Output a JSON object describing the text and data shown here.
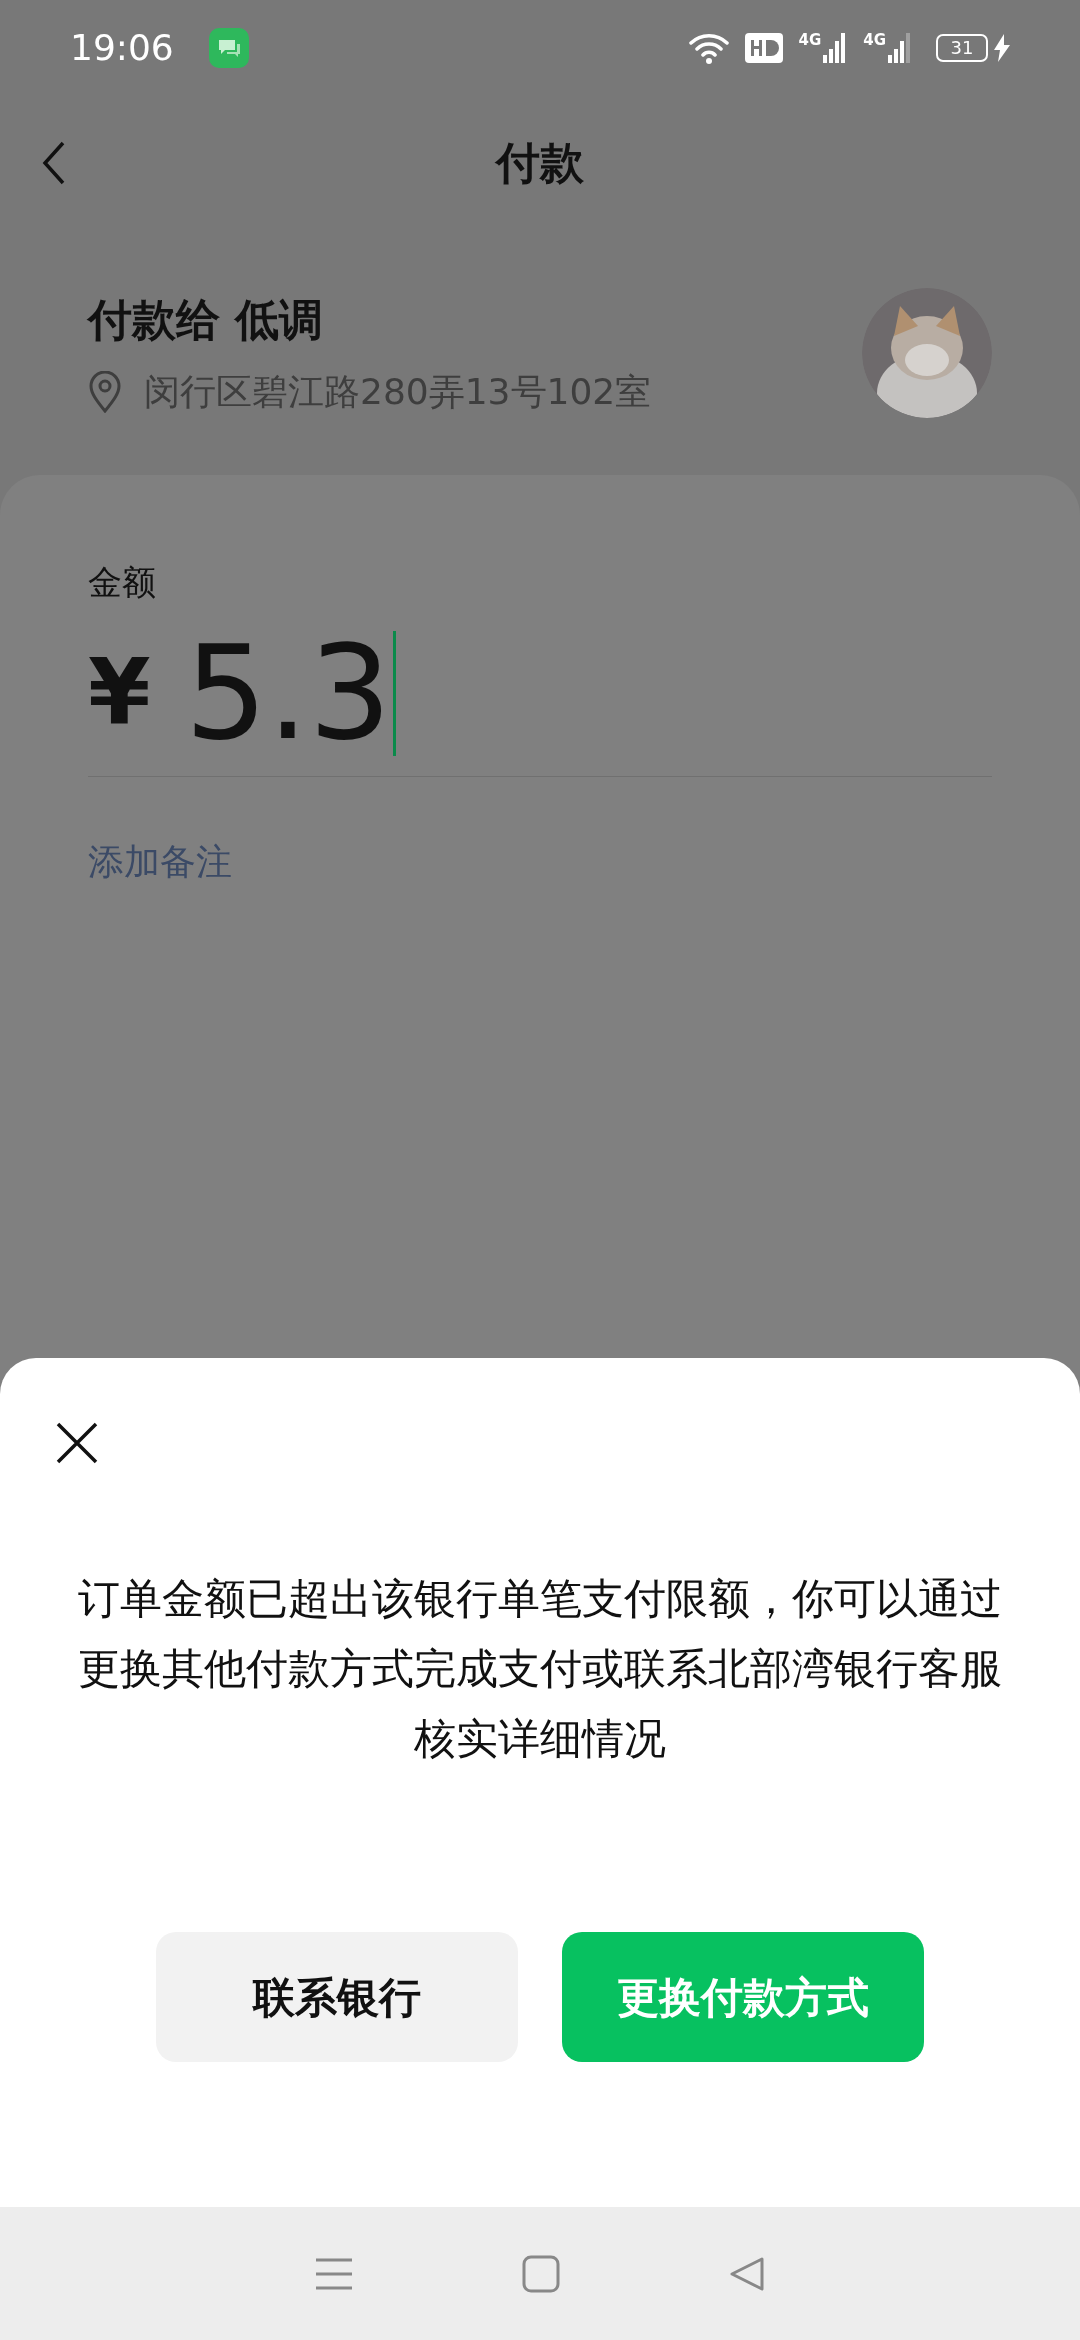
{
  "status_bar": {
    "time": "19:06",
    "networks": [
      {
        "label": "4G"
      },
      {
        "label": "4G"
      }
    ],
    "battery": "31"
  },
  "header": {
    "title": "付款"
  },
  "payee": {
    "name": "付款给 低调",
    "address": "闵行区碧江路280弄13号102室"
  },
  "amount": {
    "label": "金额",
    "currency": "¥",
    "value": "5.3"
  },
  "remark_link": "添加备注",
  "dialog": {
    "message": "订单金额已超出该银行单笔支付限额，你可以通过更换其他付款方式完成支付或联系北部湾银行客服核实详细情况",
    "buttons": [
      {
        "label": "联系银行",
        "kind": "secondary"
      },
      {
        "label": "更换付款方式",
        "kind": "primary"
      }
    ]
  }
}
